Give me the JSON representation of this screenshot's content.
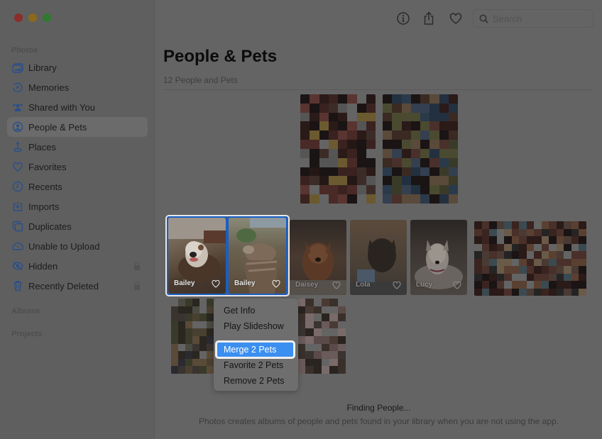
{
  "window": {
    "traffic_lights": [
      "close",
      "minimize",
      "zoom"
    ]
  },
  "sidebar": {
    "sections": {
      "photos": "Photos",
      "albums": "Albums",
      "projects": "Projects"
    },
    "items": [
      {
        "label": "Library",
        "icon": "library-icon"
      },
      {
        "label": "Memories",
        "icon": "memories-icon"
      },
      {
        "label": "Shared with You",
        "icon": "shared-icon"
      },
      {
        "label": "People & Pets",
        "icon": "people-icon",
        "active": true
      },
      {
        "label": "Places",
        "icon": "places-icon"
      },
      {
        "label": "Favorites",
        "icon": "heart-icon"
      },
      {
        "label": "Recents",
        "icon": "clock-icon"
      },
      {
        "label": "Imports",
        "icon": "import-icon"
      },
      {
        "label": "Duplicates",
        "icon": "duplicates-icon"
      },
      {
        "label": "Unable to Upload",
        "icon": "cloud-icon"
      },
      {
        "label": "Hidden",
        "icon": "eye-icon",
        "locked": true
      },
      {
        "label": "Recently Deleted",
        "icon": "trash-icon",
        "locked": true
      }
    ]
  },
  "toolbar": {
    "info_icon": "info-icon",
    "share_icon": "share-icon",
    "favorite_icon": "heart-icon",
    "search_placeholder": "Search",
    "search_value": ""
  },
  "main": {
    "title": "People & Pets",
    "subtitle": "12 People and Pets",
    "pets": [
      {
        "name": "Bailey",
        "selected": true
      },
      {
        "name": "Bailey",
        "selected": true
      },
      {
        "name": "Daisey",
        "selected": false
      },
      {
        "name": "Lola",
        "selected": false
      },
      {
        "name": "Lucy",
        "selected": false
      }
    ],
    "context_menu": {
      "items": [
        "Get Info",
        "Play Slideshow",
        "Merge 2 Pets",
        "Favorite 2 Pets",
        "Remove 2 Pets"
      ],
      "highlighted": "Merge 2 Pets"
    },
    "status_title": "Finding People...",
    "status_description": "Photos creates albums of people and pets found in your library when you are not using the app."
  },
  "colors": {
    "accent": "#3b8ff0",
    "selection": "#1a5fc4",
    "sidebar_icon": "#2a4f8a"
  }
}
